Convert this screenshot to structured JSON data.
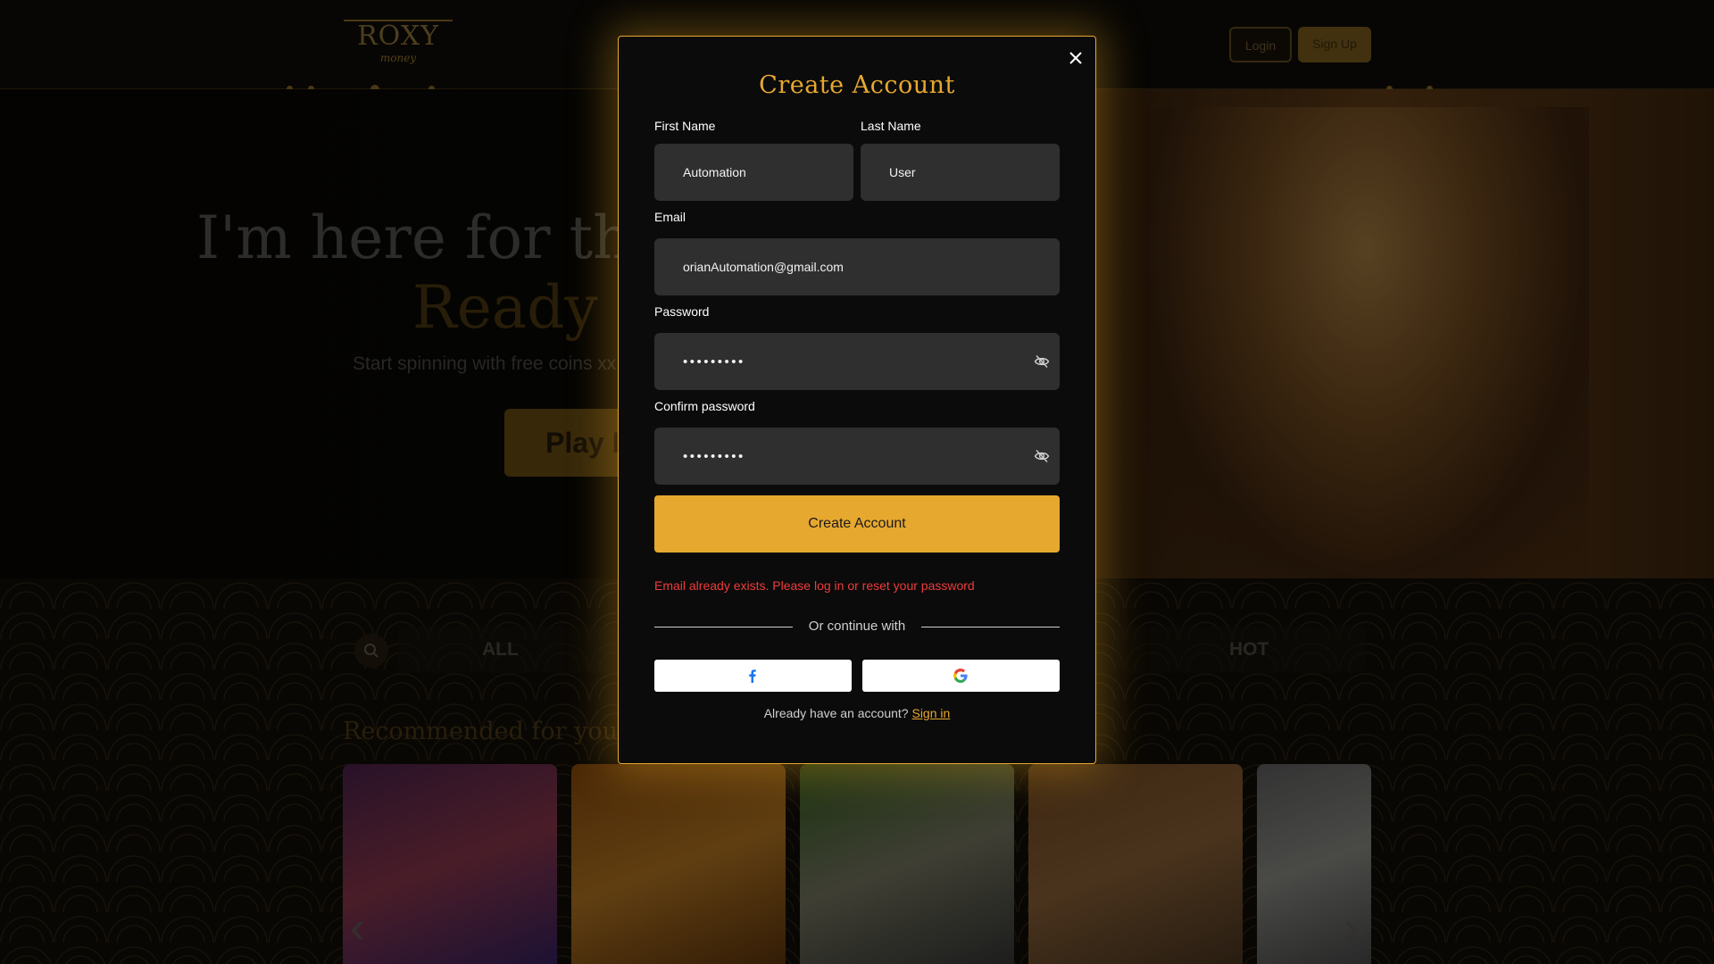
{
  "background": {
    "logo_text": "ROXY",
    "logo_subtext": "money",
    "login_label": "Login",
    "signup_label": "Sign Up",
    "hero_title_line1": "I'm here for the",
    "hero_title_line2": "Ready t",
    "hero_subtitle": "Start spinning with free coins xx",
    "play_label": "Play N",
    "tabs": {
      "all": "ALL",
      "hot": "HOT"
    },
    "recommended_title": "Recommended for you"
  },
  "modal": {
    "title": "Create Account",
    "first_name": {
      "label": "First Name",
      "value": "Automation"
    },
    "last_name": {
      "label": "Last Name",
      "value": "User"
    },
    "email": {
      "label": "Email",
      "value": "orianAutomation@gmail.com"
    },
    "password": {
      "label": "Password",
      "value": "•••••••••"
    },
    "confirm_password": {
      "label": "Confirm password",
      "value": "•••••••••"
    },
    "submit_label": "Create Account",
    "error_message": "Email already exists. Please log in or reset your password",
    "divider_text": "Or continue with",
    "signin_prompt": "Already have an account?",
    "signin_link": "Sign in",
    "icons": {
      "close": "close-icon",
      "password_toggle": "eye-off-icon",
      "facebook": "facebook-icon",
      "google": "google-icon"
    },
    "colors": {
      "accent": "#e7a82f",
      "error": "#ee3c3c",
      "modal_background": "#0b0b0b",
      "field_background": "#2f2f2f"
    }
  }
}
